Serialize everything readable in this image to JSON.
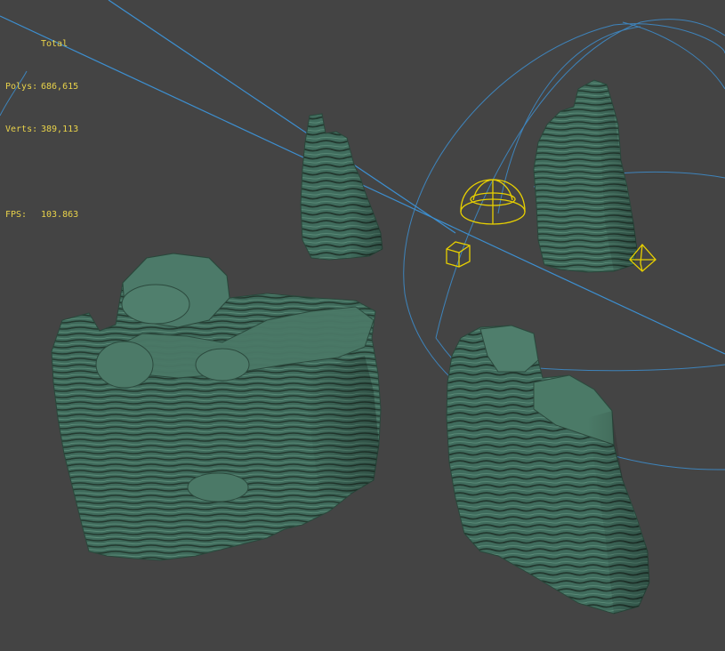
{
  "viewport": {
    "background": "#444444",
    "stats": {
      "title": "Total",
      "polys_label": "Polys:",
      "polys_value": "686,615",
      "verts_label": "Verts:",
      "verts_value": "389,113",
      "fps_label": "FPS:",
      "fps_value": "103.863",
      "color": "#e8d24a"
    },
    "colors": {
      "rock": "#3f6a5b",
      "rock_dark": "#274339",
      "rock_light": "#5c8a78",
      "gizmo_yellow": "#e8d000",
      "wire_blue": "#3d8fd0"
    },
    "objects": [
      {
        "type": "rock-formation",
        "name": "large rock"
      },
      {
        "type": "rock-formation",
        "name": "tall rock center"
      },
      {
        "type": "rock-formation",
        "name": "tall rock right"
      },
      {
        "type": "rock-formation",
        "name": "rock bottom right"
      },
      {
        "type": "light",
        "icon": "skylight-dome-icon"
      },
      {
        "type": "light",
        "icon": "omni-light-icon"
      },
      {
        "type": "camera-target",
        "icon": "target-cube-icon"
      }
    ]
  }
}
